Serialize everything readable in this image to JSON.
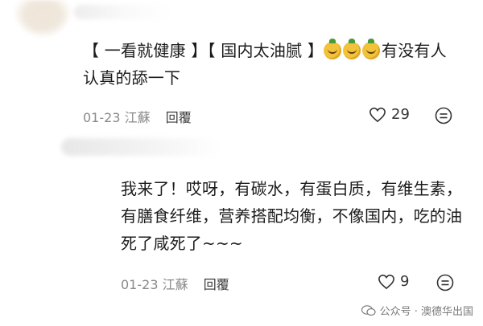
{
  "comments": [
    {
      "text": "【 一看就健康 】【 国内太油腻 】",
      "text_after_emoji": "有没有人认真的舔一下",
      "emoji_icon": "lemon-face-emoji",
      "emoji_count": 3,
      "date": "01-23",
      "location": "江蘇",
      "reply_label": "回覆",
      "likes": "29"
    },
    {
      "text": "我来了！哎呀，有碳水，有蛋白质，有维生素，有膳食纤维，营养搭配均衡，不像国内，吃的油死了咸死了~~~",
      "date": "01-23",
      "location": "江蘇",
      "reply_label": "回覆",
      "likes": "9"
    }
  ],
  "watermark": {
    "text": "公众号 · 澳德华出国",
    "icon": "wechat-icon"
  }
}
